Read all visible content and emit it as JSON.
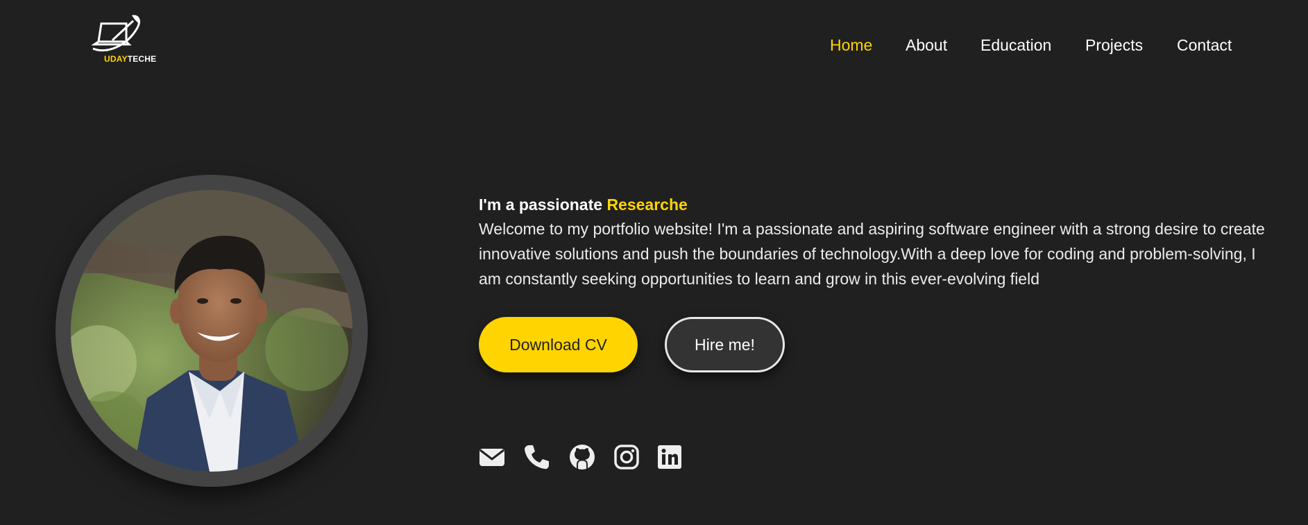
{
  "logo": {
    "word1": "UDAY",
    "word2": "TECHE",
    "icon": "laptop-swoosh-icon"
  },
  "nav": {
    "items": [
      {
        "label": "Home",
        "active": true
      },
      {
        "label": "About",
        "active": false
      },
      {
        "label": "Education",
        "active": false
      },
      {
        "label": "Projects",
        "active": false
      },
      {
        "label": "Contact",
        "active": false
      }
    ]
  },
  "profile": {
    "photo": "profile-photo"
  },
  "intro": {
    "headline_prefix": "I'm a passionate ",
    "headline_highlight": "Researche",
    "body": "Welcome to my portfolio website! I'm a passionate and aspiring software engineer with a strong desire to create innovative solutions and push the boundaries of technology.With a deep love for coding and problem-solving, I am constantly seeking opportunities to learn and grow in this ever-evolving field"
  },
  "buttons": {
    "download_cv": "Download CV",
    "hire_me": "Hire me!"
  },
  "socials": [
    {
      "name": "email-icon"
    },
    {
      "name": "phone-icon"
    },
    {
      "name": "github-icon"
    },
    {
      "name": "instagram-icon"
    },
    {
      "name": "linkedin-icon"
    }
  ],
  "colors": {
    "background": "#202020",
    "accent": "#ffd400",
    "text": "#ffffff",
    "ring": "#444444"
  }
}
